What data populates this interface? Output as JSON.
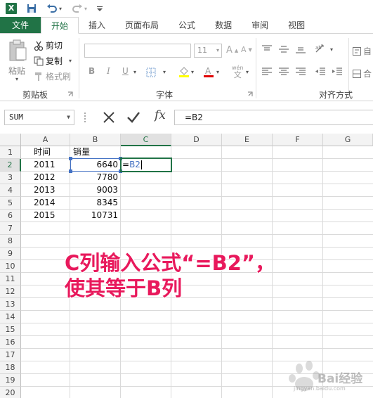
{
  "qat": {
    "logo": "X",
    "undo_icon": "undo-icon",
    "redo_icon": "redo-icon"
  },
  "tabs": [
    "文件",
    "开始",
    "插入",
    "页面布局",
    "公式",
    "数据",
    "审阅",
    "视图"
  ],
  "active_tab": "开始",
  "ribbon": {
    "clipboard": {
      "paste": "粘贴",
      "cut": "剪切",
      "copy": "复制",
      "format_painter": "格式刷",
      "group_label": "剪贴板"
    },
    "font": {
      "font_name": "",
      "font_size": "11",
      "bold": "B",
      "italic": "I",
      "underline": "U",
      "wen": "wén",
      "wen_char": "文",
      "group_label": "字体"
    },
    "alignment": {
      "group_label": "对齐方式",
      "wrap_label": "自",
      "merge_label": "合"
    }
  },
  "formula_bar": {
    "name_box": "SUM",
    "formula": "=B2",
    "cancel_icon": "cancel-x-icon",
    "enter_icon": "checkmark-icon",
    "fx": "fx"
  },
  "grid": {
    "columns": [
      "A",
      "B",
      "C",
      "D",
      "E",
      "F",
      "G"
    ],
    "selected_column": "C",
    "rows": [
      "1",
      "2",
      "3",
      "4",
      "5",
      "6",
      "7",
      "8",
      "9",
      "10",
      "11",
      "12",
      "13",
      "14",
      "15",
      "16",
      "17",
      "18",
      "19",
      "20"
    ],
    "selected_row": "2",
    "header_a1": "时间",
    "header_b1": "销量",
    "data": [
      {
        "year": "2011",
        "sales": "6640"
      },
      {
        "year": "2012",
        "sales": "7780"
      },
      {
        "year": "2013",
        "sales": "9003"
      },
      {
        "year": "2014",
        "sales": "8345"
      },
      {
        "year": "2015",
        "sales": "10731"
      }
    ],
    "editing_cell": {
      "prefix": "=",
      "ref": "B2"
    }
  },
  "annotation": {
    "line1": "C列输入公式“=B2”，",
    "line2": "使其等于B列"
  },
  "watermark": {
    "text": "Bai经验",
    "sub": "jingyan.baidu.com"
  }
}
